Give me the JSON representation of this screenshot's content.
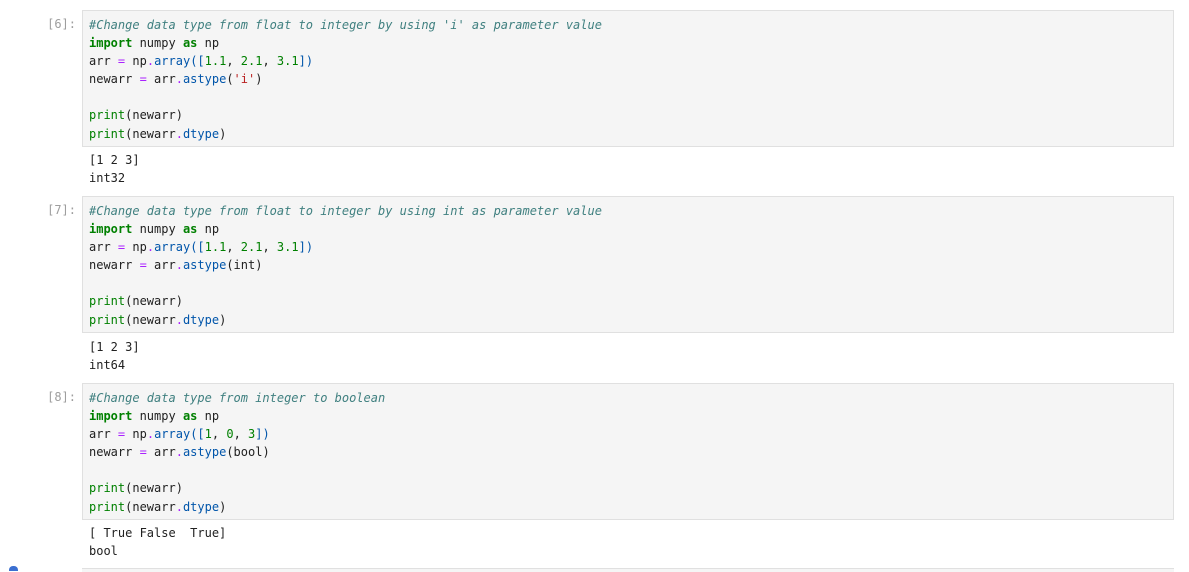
{
  "cells": [
    {
      "prompt": "[6]:",
      "code": {
        "comment": "#Change data type from float to integer by using 'i' as parameter value",
        "import_kw": "import",
        "import_mod": " numpy ",
        "as_kw": "as",
        "import_alias": " np",
        "arr_name": "arr ",
        "arr_eq": "=",
        "arr_np": " np",
        "arr_dot": ".",
        "arr_fn": "array",
        "arr_open": "([",
        "arr_v1": "1.1",
        "arr_sep1": ", ",
        "arr_v2": "2.1",
        "arr_sep2": ", ",
        "arr_v3": "3.1",
        "arr_close": "])",
        "new_name": "newarr ",
        "new_eq": "=",
        "new_obj": " arr",
        "new_dot": ".",
        "new_fn": "astype",
        "new_open": "(",
        "new_arg": "'i'",
        "new_close": ")",
        "p1_fn": "print",
        "p1_args": "(newarr)",
        "p2_fn": "print",
        "p2_open": "(newarr",
        "p2_dot": ".",
        "p2_attr": "dtype",
        "p2_close": ")"
      },
      "output": [
        "[1 2 3]",
        "int32"
      ]
    },
    {
      "prompt": "[7]:",
      "code": {
        "comment": "#Change data type from float to integer by using int as parameter value",
        "import_kw": "import",
        "import_mod": " numpy ",
        "as_kw": "as",
        "import_alias": " np",
        "arr_name": "arr ",
        "arr_eq": "=",
        "arr_np": " np",
        "arr_dot": ".",
        "arr_fn": "array",
        "arr_open": "([",
        "arr_v1": "1.1",
        "arr_sep1": ", ",
        "arr_v2": "2.1",
        "arr_sep2": ", ",
        "arr_v3": "3.1",
        "arr_close": "])",
        "new_name": "newarr ",
        "new_eq": "=",
        "new_obj": " arr",
        "new_dot": ".",
        "new_fn": "astype",
        "new_open": "(",
        "new_arg": "int",
        "new_close": ")",
        "p1_fn": "print",
        "p1_args": "(newarr)",
        "p2_fn": "print",
        "p2_open": "(newarr",
        "p2_dot": ".",
        "p2_attr": "dtype",
        "p2_close": ")"
      },
      "output": [
        "[1 2 3]",
        "int64"
      ]
    },
    {
      "prompt": "[8]:",
      "code": {
        "comment": "#Change data type from integer to boolean",
        "import_kw": "import",
        "import_mod": " numpy ",
        "as_kw": "as",
        "import_alias": " np",
        "arr_name": "arr ",
        "arr_eq": "=",
        "arr_np": " np",
        "arr_dot": ".",
        "arr_fn": "array",
        "arr_open": "([",
        "arr_v1": "1",
        "arr_sep1": ", ",
        "arr_v2": "0",
        "arr_sep2": ", ",
        "arr_v3": "3",
        "arr_close": "])",
        "new_name": "newarr ",
        "new_eq": "=",
        "new_obj": " arr",
        "new_dot": ".",
        "new_fn": "astype",
        "new_open": "(",
        "new_arg": "bool",
        "new_close": ")",
        "p1_fn": "print",
        "p1_args": "(newarr)",
        "p2_fn": "print",
        "p2_open": "(newarr",
        "p2_dot": ".",
        "p2_attr": "dtype",
        "p2_close": ")"
      },
      "output": [
        "[ True False  True]",
        "bool"
      ]
    }
  ]
}
